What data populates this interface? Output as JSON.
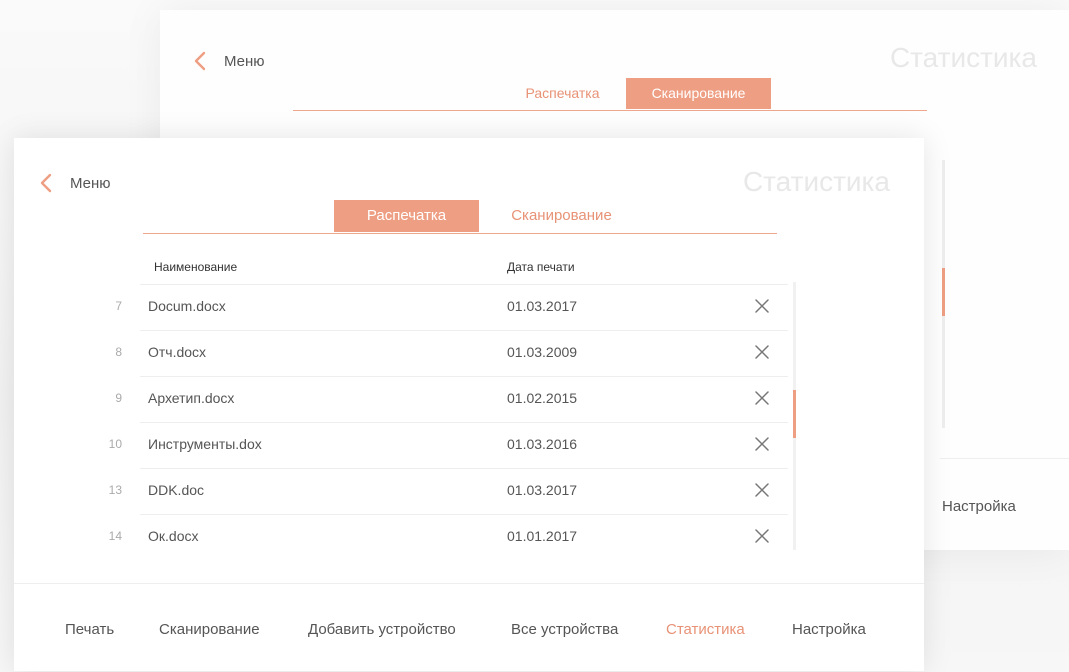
{
  "back_window": {
    "menu_label": "Меню",
    "title": "Статистика",
    "tabs": [
      {
        "label": "Распечатка",
        "active": false
      },
      {
        "label": "Сканирование",
        "active": true
      }
    ],
    "footer_item": "Настройка"
  },
  "front_window": {
    "menu_label": "Меню",
    "title": "Статистика",
    "tabs": [
      {
        "label": "Распечатка",
        "active": true
      },
      {
        "label": "Сканирование",
        "active": false
      }
    ],
    "table": {
      "columns": {
        "name": "Наименование",
        "date": "Дата печати"
      },
      "rows": [
        {
          "num": "7",
          "name": "Docum.docx",
          "date": "01.03.2017"
        },
        {
          "num": "8",
          "name": "Отч.docx",
          "date": "01.03.2009"
        },
        {
          "num": "9",
          "name": "Архетип.docx",
          "date": "01.02.2015"
        },
        {
          "num": "10",
          "name": "Инструменты.dox",
          "date": "01.03.2016"
        },
        {
          "num": "13",
          "name": "DDK.doc",
          "date": "01.03.2017"
        },
        {
          "num": "14",
          "name": "Ок.docx",
          "date": "01.01.2017"
        }
      ]
    },
    "footer_nav": [
      {
        "label": "Печать"
      },
      {
        "label": "Сканирование"
      },
      {
        "label": "Добавить устройство"
      },
      {
        "label": "Все устройства"
      },
      {
        "label": "Статистика",
        "active": true
      },
      {
        "label": "Настройка"
      }
    ]
  },
  "colors": {
    "accent": "#ee9e82",
    "accent_text": "#e89276",
    "text": "#555555",
    "title_faded": "#e8e8e8"
  },
  "icons": {
    "back": "chevron-left-icon",
    "delete": "close-icon"
  }
}
